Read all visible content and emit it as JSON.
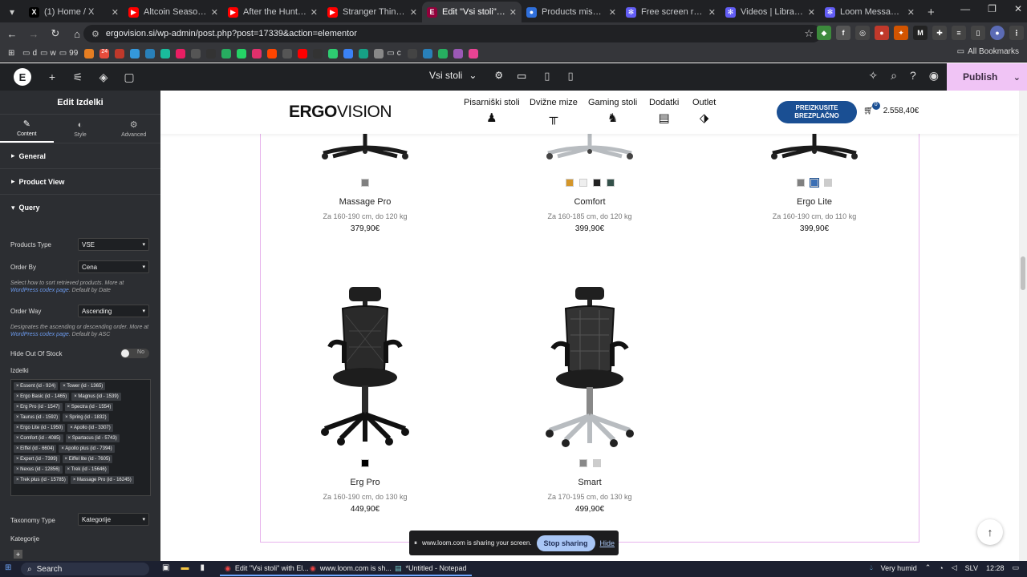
{
  "browser": {
    "tabs": [
      {
        "title": "(1) Home / X",
        "icon": "x-logo-icon",
        "color": "#000000",
        "glyph": "X"
      },
      {
        "title": "Altcoin Season → IT S",
        "icon": "youtube-icon",
        "color": "#ff0000",
        "glyph": "▶"
      },
      {
        "title": "After the Hunt Trailer",
        "icon": "youtube-icon",
        "color": "#ff0000",
        "glyph": "▶"
      },
      {
        "title": "Stranger Things Seas",
        "icon": "youtube-icon",
        "color": "#ff0000",
        "glyph": "▶"
      },
      {
        "title": "Edit \"Vsi stoli\" with El",
        "icon": "elementor-icon",
        "color": "#92003b",
        "glyph": "E"
      },
      {
        "title": "Products missing fro",
        "icon": "chat-icon",
        "color": "#2f6fdb",
        "glyph": "●"
      },
      {
        "title": "Free screen recorder",
        "icon": "loom-icon",
        "color": "#625df5",
        "glyph": "✻"
      },
      {
        "title": "Videos | Library | Loo",
        "icon": "loom-icon",
        "color": "#625df5",
        "glyph": "✻"
      },
      {
        "title": "Loom Message -",
        "icon": "loom-icon",
        "color": "#625df5",
        "glyph": "✻"
      }
    ],
    "url": "ergovision.si/wp-admin/post.php?post=17339&action=elementor",
    "all_bookmarks": "All Bookmarks",
    "bookmarks": [
      "d",
      "w",
      "99",
      "24",
      "c"
    ]
  },
  "editor": {
    "page_selector": "Vsi stoli",
    "publish_label": "Publish"
  },
  "panel": {
    "title": "Edit Izdelki",
    "tabs": [
      "Content",
      "Style",
      "Advanced"
    ],
    "sections": [
      "General",
      "Product View",
      "Query"
    ],
    "products_type_label": "Products Type",
    "products_type_value": "VSE",
    "order_by_label": "Order By",
    "order_by_value": "Cena",
    "order_by_help": "Select how to sort retrieved products. More at",
    "order_by_help_link": "WordPress codex page",
    "order_by_help_tail": ". Default by Date",
    "order_way_label": "Order Way",
    "order_way_value": "Ascending",
    "order_way_help": "Designates the ascending or descending order. More at",
    "order_way_help_link": "WordPress codex page",
    "order_way_help_tail": ". Default by ASC",
    "hide_oos_label": "Hide Out Of Stock",
    "hide_oos_value": "No",
    "izdelki_label": "Izdelki",
    "tags": [
      "× Essent (id - 924)",
      "× Tower (id - 1365)",
      "× Ergo Basic (id - 1465)",
      "× Magnus (id - 1539)",
      "× Erg Pro (id - 1547)",
      "× Spectra (id - 1554)",
      "× Taurus (id - 1592)",
      "× Spring (id - 1832)",
      "× Ergo Lite (id - 1950)",
      "× Apollo (id - 3307)",
      "× Comfort (id - 4085)",
      "× Spartacus (id - 5743)",
      "× Eiffel (id - 6604)",
      "× Apollo plus (id - 7394)",
      "× Expert (id - 7399)",
      "× Eiffel lite (id - 7605)",
      "× Nexus (id - 12856)",
      "× Trek (id - 15646)",
      "× Trek plus (id - 15785)",
      "× Massage Pro (id - 16245)"
    ],
    "taxonomy_label": "Taxonomy Type",
    "taxonomy_value": "Kategorije",
    "kategorije_label": "Kategorije"
  },
  "site": {
    "logo_bold": "ERGO",
    "logo_rest": "VISION",
    "menu": [
      "Pisarniški stoli",
      "Dvižne mize",
      "Gaming stoli",
      "Dodatki",
      "Outlet"
    ],
    "cta_line1": "PREIZKUSITE",
    "cta_line2": "BREZPLAČNO",
    "cart_count": "0",
    "cart_total": "2.558,40€"
  },
  "products": [
    {
      "name": "Massage Pro",
      "desc": "Za 160-190 cm, do 120 kg",
      "price": "379,90€",
      "swatches": [
        "#808080"
      ]
    },
    {
      "name": "Comfort",
      "desc": "Za 160-185 cm, do 120 kg",
      "price": "399,90€",
      "swatches": [
        "#d4962a",
        "#eeeeee",
        "#222222",
        "#34514a"
      ]
    },
    {
      "name": "Ergo Lite",
      "desc": "Za 160-190 cm, do 110 kg",
      "price": "399,90€",
      "swatches": [
        "#808080",
        "#3a6fb5",
        "#cccccc"
      ]
    },
    {
      "name": "Erg Pro",
      "desc": "Za 160-190 cm, do 130 kg",
      "price": "449,90€",
      "swatches": [
        "#000000"
      ]
    },
    {
      "name": "Smart",
      "desc": "Za 170-195 cm, do 130 kg",
      "price": "499,90€",
      "swatches": [
        "#888888",
        "#cccccc"
      ]
    }
  ],
  "loom": {
    "message": "www.loom.com is sharing your screen.",
    "stop_label": "Stop sharing",
    "hide_label": "Hide"
  },
  "taskbar": {
    "search_placeholder": "Search",
    "apps": [
      "Edit \"Vsi stoli\" with El...",
      "www.loom.com is sh...",
      "*Untitled - Notepad"
    ],
    "weather": "Very humid",
    "lang": "SLV",
    "time": "12:28"
  }
}
